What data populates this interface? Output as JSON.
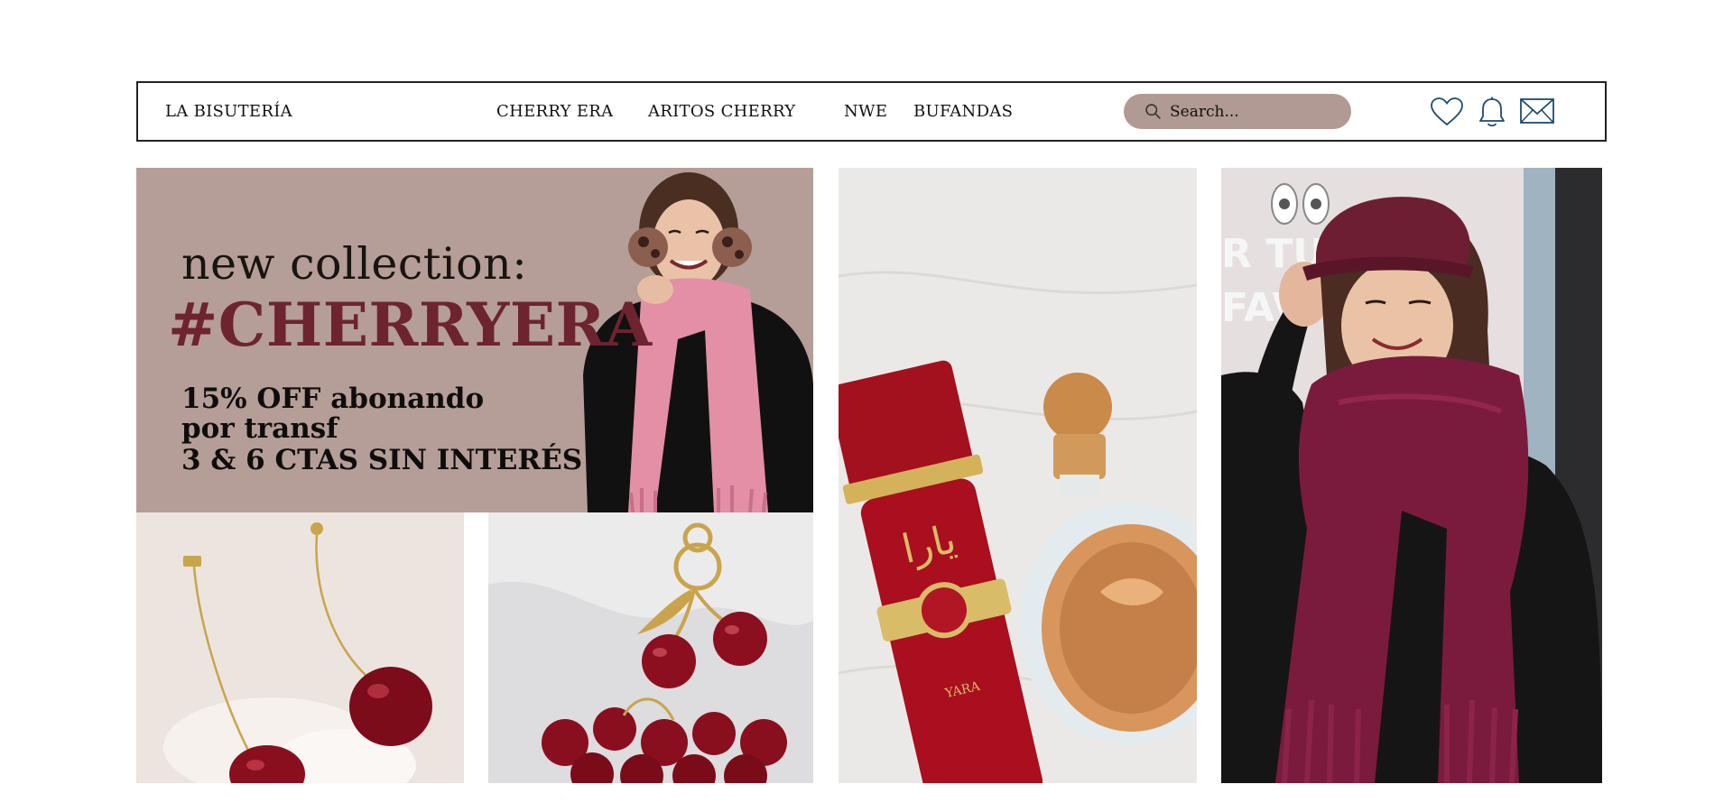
{
  "nav": {
    "brand": "LA BISUTERÍA",
    "links": [
      "CHERRY ERA",
      "ARITOS CHERRY",
      "NWE",
      "BUFANDAS"
    ],
    "search_placeholder": "Search...",
    "icons": [
      "heart-icon",
      "bell-icon",
      "mail-icon"
    ]
  },
  "promo": {
    "subtitle": "new collection:",
    "title": "#CHERRYERA",
    "offer_line1": "15% OFF abonando por transf",
    "offer_line2": "3 & 6 CTAS SIN INTERÉS"
  },
  "perfume": {
    "bottle_label": "YARA"
  },
  "colors": {
    "accent": "#6e2331",
    "promo_bg": "#b49e97",
    "search_bg": "#b09a93",
    "cherry_red": "#8a0f1e"
  }
}
